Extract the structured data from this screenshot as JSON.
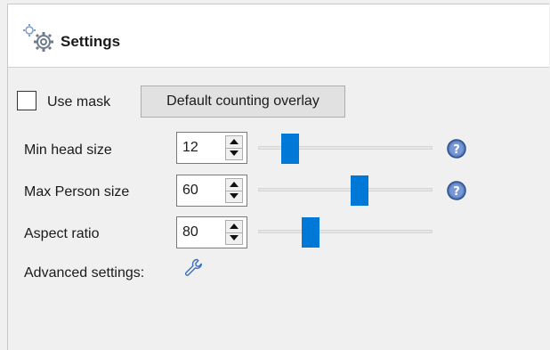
{
  "header": {
    "title": "Settings",
    "icon": "gear-icon"
  },
  "mask": {
    "checkbox_label": "Use mask",
    "checked": false,
    "overlay_button": "Default counting overlay"
  },
  "params": [
    {
      "label": "Min head size",
      "value": "12",
      "slider_fraction": 0.15,
      "has_help": true
    },
    {
      "label": "Max Person size",
      "value": "60",
      "slider_fraction": 0.59,
      "has_help": true
    },
    {
      "label": "Aspect ratio",
      "value": "80",
      "slider_fraction": 0.28,
      "has_help": false
    }
  ],
  "advanced": {
    "label": "Advanced settings:",
    "icon": "wrench-icon"
  },
  "colors": {
    "accent": "#0078d7",
    "help": "#4a6fb5"
  }
}
